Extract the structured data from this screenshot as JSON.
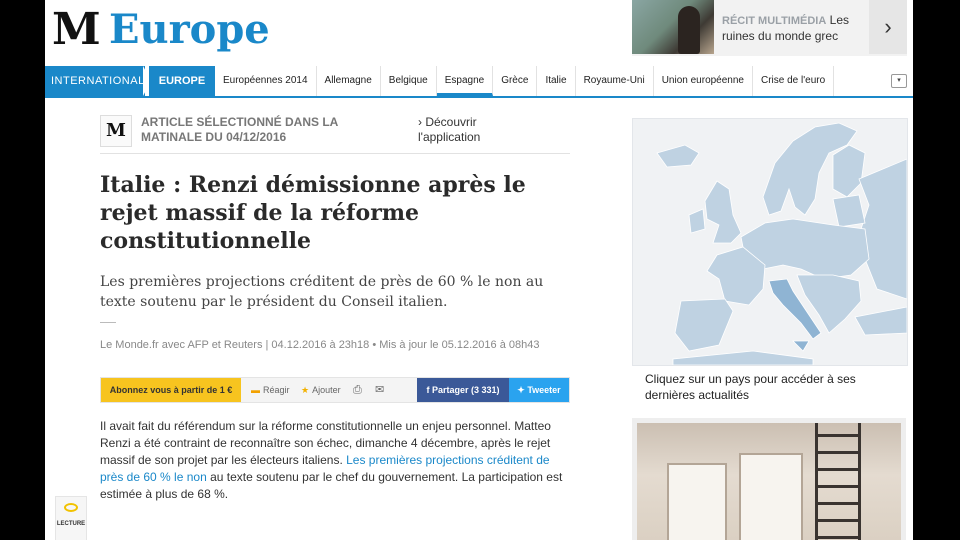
{
  "brand": {
    "logo": "M",
    "section": "Europe"
  },
  "promo": {
    "kicker": "RÉCIT MULTIMÉDIA",
    "text": "Les ruines du monde grec",
    "arrow": "›"
  },
  "nav": {
    "international": "INTERNATIONAL",
    "europe": "EUROPE",
    "items": [
      "Européennes 2014",
      "Allemagne",
      "Belgique",
      "Espagne",
      "Grèce",
      "Italie",
      "Royaume-Uni",
      "Union européenne",
      "Crise de l'euro"
    ],
    "toggle": "▾"
  },
  "selection": {
    "logo": "M",
    "text": "ARTICLE SÉLECTIONNÉ DANS LA MATINALE DU 04/12/2016",
    "app": "› Découvrir l'application"
  },
  "article": {
    "title": "Italie : Renzi démissionne après le rejet massif de la réforme constitutionnelle",
    "lead": "Les premières projections créditent de près de 60 % le non au texte soutenu par le président du Conseil italien.",
    "meta": "Le Monde.fr avec AFP et Reuters | 04.12.2016 à 23h18 • Mis à jour le 05.12.2016 à 08h43",
    "body_1": "Il avait fait du référendum sur la réforme constitutionnelle un enjeu personnel. Matteo Renzi a été contraint de reconnaître son échec, dimanche 4 décembre, après le rejet massif de son projet par les électeurs italiens. ",
    "body_link": "Les premières projections créditent de près de 60 % le non",
    "body_2": " au texte soutenu par le chef du gouvernement. La participation est estimée à plus de 68 %."
  },
  "actions": {
    "subscribe": "Abonnez vous à partir de 1 €",
    "react": "Réagir",
    "add": "Ajouter",
    "facebook": "Partager (3 331)",
    "twitter": "Tweeter"
  },
  "reading": {
    "label": "LECTURE"
  },
  "map": {
    "caption": "Cliquez sur un pays pour accéder à ses dernières actualités",
    "sea_color": "#f0f2f4",
    "land_color": "#bfd2e2",
    "highlight_color": "#8fb4d3"
  }
}
